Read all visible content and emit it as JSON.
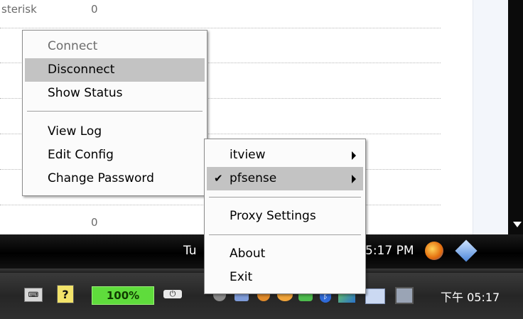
{
  "background": {
    "header_label": "sterisk",
    "header_value": "0",
    "bottom_value": "0"
  },
  "main_menu": {
    "items": [
      {
        "label": "Connect",
        "disabled": true
      },
      {
        "label": "Disconnect",
        "highlighted": true
      },
      {
        "label": "Show Status"
      },
      {
        "label": "View Log"
      },
      {
        "label": "Edit Config"
      },
      {
        "label": "Change Password"
      }
    ]
  },
  "tray_menu": {
    "items": [
      {
        "label": "itview",
        "submenu": true
      },
      {
        "label": "pfsense",
        "submenu": true,
        "checked": true,
        "highlighted": true
      },
      {
        "label": "Proxy Settings"
      },
      {
        "label": "About"
      },
      {
        "label": "Exit"
      }
    ]
  },
  "taskbar_top": {
    "date_fragment": "Tu",
    "time": "5:17 PM"
  },
  "taskbar_bottom": {
    "battery": "100%",
    "clock": "下午 05:17"
  },
  "icons": [
    "keyboard-icon",
    "help-icon",
    "power-plug-icon",
    "firefox-icon",
    "network-icon",
    "shield-icon",
    "chat-icon",
    "printer-icon",
    "bluetooth-icon",
    "network-share-icon",
    "mail-icon",
    "monitor-icon"
  ]
}
